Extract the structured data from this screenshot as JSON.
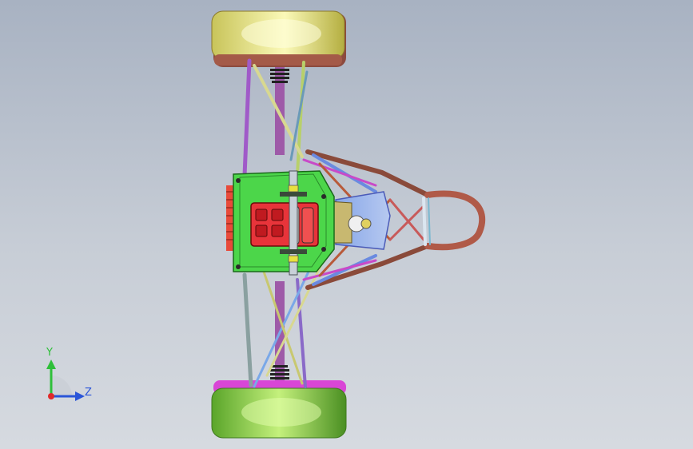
{
  "viewport": {
    "background_top": "#a8b2c2",
    "background_bottom": "#d6dae0"
  },
  "model": {
    "wheel_top_color": "#e8e67a",
    "wheel_bottom_color": "#8ad13a",
    "wheel_bottom_rim_color": "#d946d6",
    "chassis_plate_color": "#4cd64a",
    "engine_color": "#e8343a"
  },
  "triad": {
    "y_label": "Y",
    "z_label": "Z",
    "y_color": "#2fbf3a",
    "z_color": "#2a55d8",
    "x_color": "#e02a2a"
  }
}
